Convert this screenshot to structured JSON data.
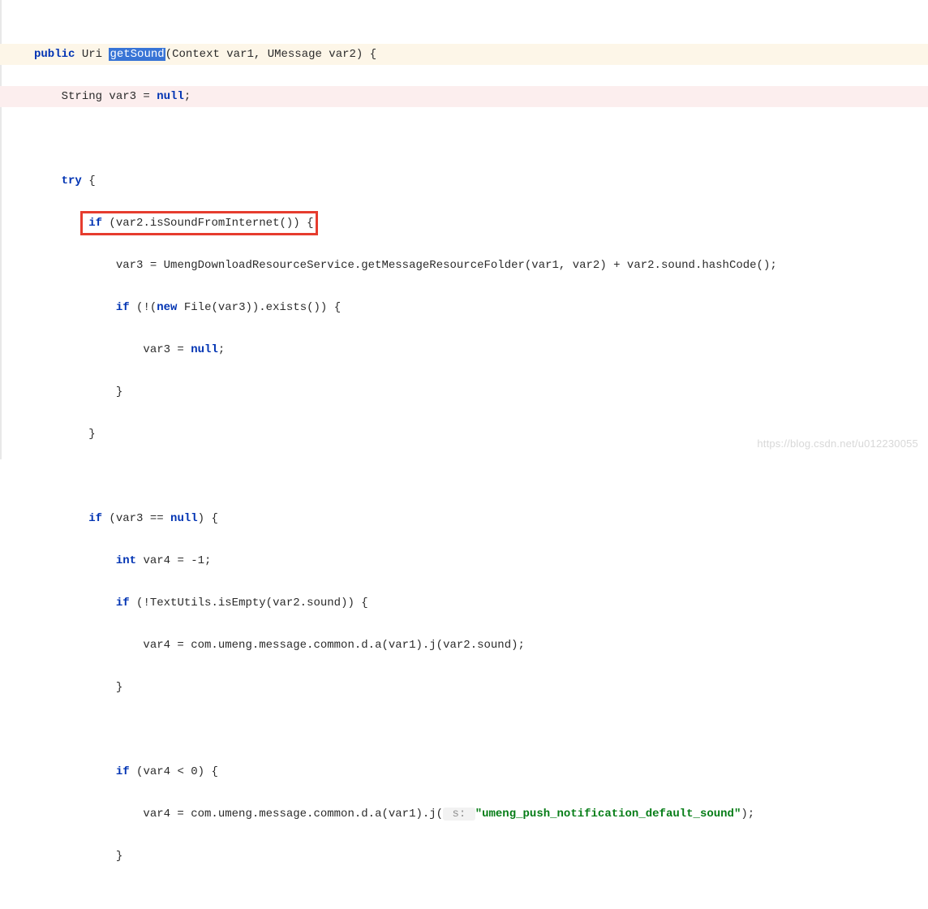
{
  "code": {
    "line1": {
      "kw_public": "public",
      "type_uri": "Uri",
      "method_name": "getSound",
      "params": "(Context var1, UMessage var2) {"
    },
    "line2": {
      "type_string": "String var3 = ",
      "kw_null": "null",
      "semi": ";"
    },
    "line4": {
      "kw_try": "try",
      "brace": " {"
    },
    "line5": {
      "kw_if": "if",
      "cond": " (var2.isSoundFromInternet()) {"
    },
    "line6": {
      "text": "var3 = UmengDownloadResourceService.getMessageResourceFolder(var1, var2) + var2.sound.hashCode();"
    },
    "line7": {
      "kw_if": "if",
      "p1": " (!(",
      "kw_new": "new",
      "p2": " File(var3)).exists()) {"
    },
    "line8": {
      "p1": "var3 = ",
      "kw_null": "null",
      "semi": ";"
    },
    "line9": {
      "brace": "}"
    },
    "line10": {
      "brace": "}"
    },
    "line12": {
      "kw_if": "if",
      "p1": " (var3 == ",
      "kw_null": "null",
      "p2": ") {"
    },
    "line13": {
      "kw_int": "int",
      "rest": " var4 = -1;"
    },
    "line14": {
      "kw_if": "if",
      "rest": " (!TextUtils.isEmpty(var2.sound)) {"
    },
    "line15": {
      "text": "var4 = com.umeng.message.common.d.a(var1).j(var2.sound);"
    },
    "line16": {
      "brace": "}"
    },
    "line18": {
      "kw_if": "if",
      "rest": " (var4 < 0) {"
    },
    "line19": {
      "p1": "var4 = com.umeng.message.common.d.a(var1).j(",
      "hint": " s: ",
      "str": "\"umeng_push_notification_default_sound\"",
      "p2": ");"
    },
    "line20": {
      "brace": "}"
    }
  },
  "watermark": "https://blog.csdn.net/u012230055"
}
